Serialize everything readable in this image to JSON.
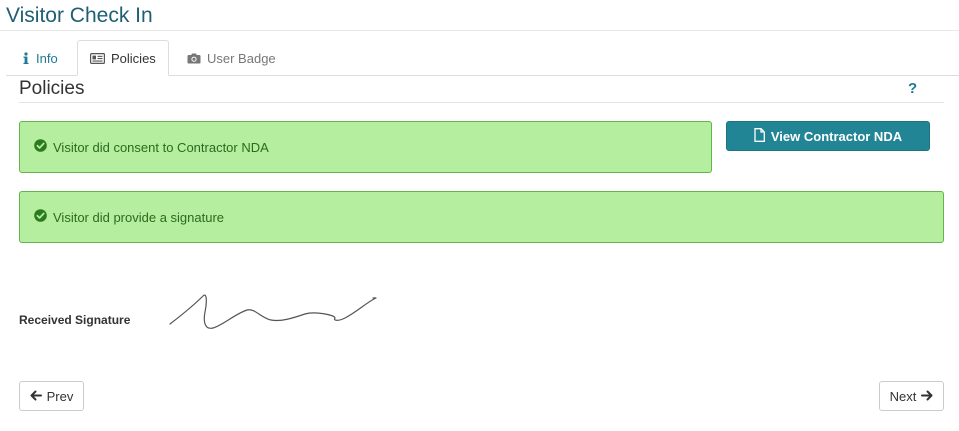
{
  "header": {
    "title": "Visitor Check In"
  },
  "tabs": [
    {
      "label": "Info",
      "icon": "info-icon"
    },
    {
      "label": "Policies",
      "icon": "id-card-icon",
      "active": true
    },
    {
      "label": "User Badge",
      "icon": "camera-icon"
    }
  ],
  "section": {
    "title": "Policies",
    "help": "?"
  },
  "alerts": {
    "nda": "Visitor did consent to Contractor NDA",
    "signature": "Visitor did provide a signature"
  },
  "buttons": {
    "view_nda": "View Contractor NDA",
    "prev": "Prev",
    "next": "Next"
  },
  "signature": {
    "label": "Received Signature"
  },
  "colors": {
    "title": "#1f5f73",
    "accent": "#218595",
    "success_bg": "#b4ee9e",
    "success_text": "#2b6b1f"
  }
}
